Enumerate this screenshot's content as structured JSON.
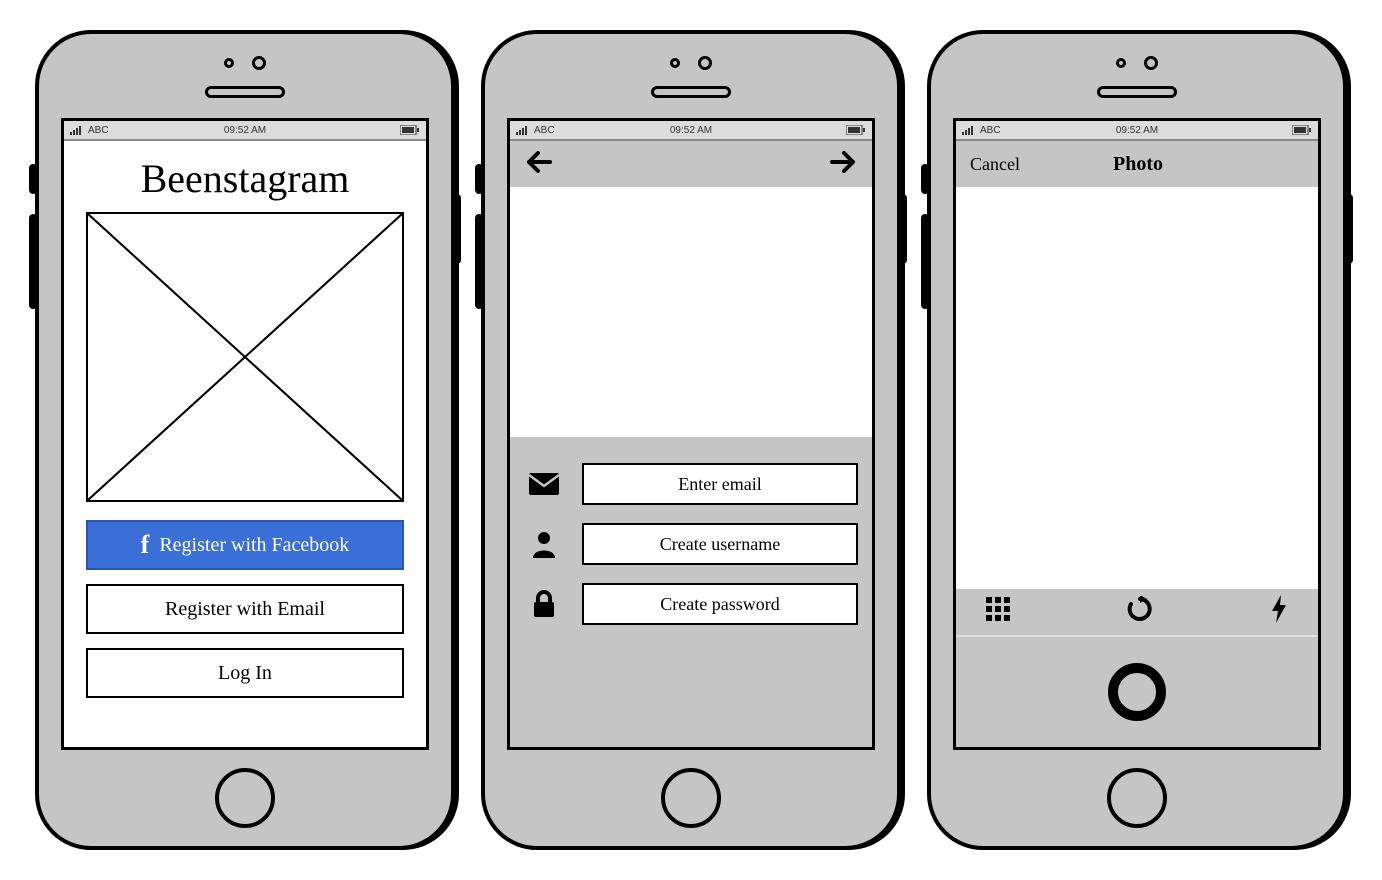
{
  "status": {
    "carrier": "ABC",
    "time": "09:52 AM"
  },
  "screen1": {
    "title": "Beenstagram",
    "fb_label": "Register with Facebook",
    "email_label": "Register with Email",
    "login_label": "Log In"
  },
  "screen2": {
    "email_placeholder": "Enter email",
    "username_placeholder": "Create username",
    "password_placeholder": "Create password"
  },
  "screen3": {
    "cancel_label": "Cancel",
    "title": "Photo"
  }
}
